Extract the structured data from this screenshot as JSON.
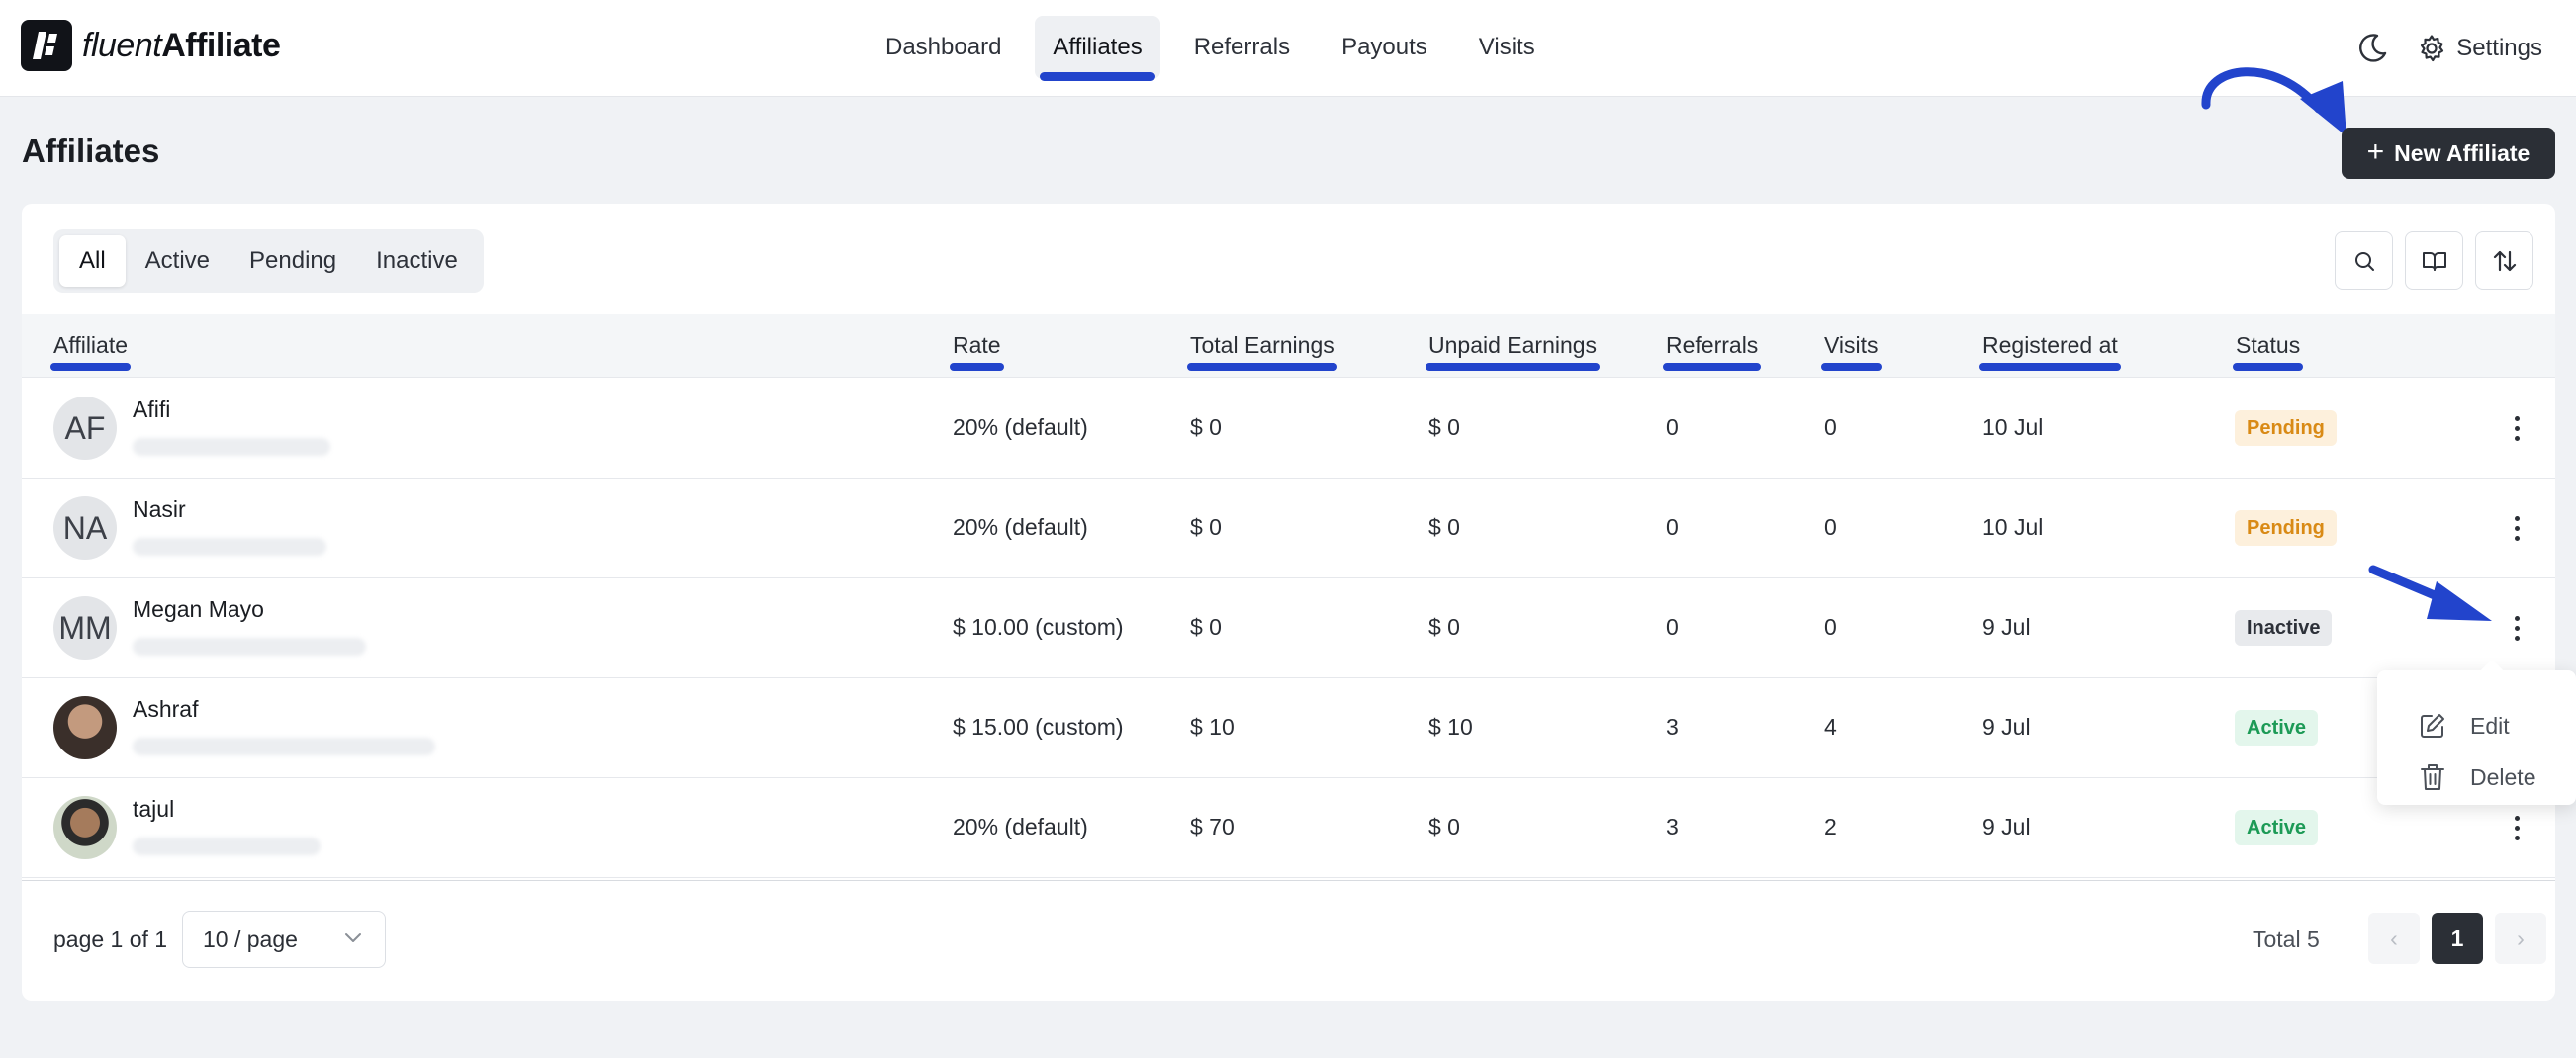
{
  "app": {
    "logo_light": "fluent",
    "logo_bold": "Affiliate"
  },
  "nav": {
    "items": [
      "Dashboard",
      "Affiliates",
      "Referrals",
      "Payouts",
      "Visits"
    ],
    "active": "Affiliates"
  },
  "header": {
    "settings_label": "Settings"
  },
  "page": {
    "title": "Affiliates",
    "new_button": "New Affiliate"
  },
  "filters": {
    "tabs": [
      "All",
      "Active",
      "Pending",
      "Inactive"
    ],
    "active": "All"
  },
  "table": {
    "columns": [
      "Affiliate",
      "Rate",
      "Total Earnings",
      "Unpaid Earnings",
      "Referrals",
      "Visits",
      "Registered at",
      "Status"
    ],
    "rows": [
      {
        "initials": "AF",
        "name": "Afifi",
        "rate": "20% (default)",
        "total": "$ 0",
        "unpaid": "$ 0",
        "referrals": "0",
        "visits": "0",
        "registered": "10 Jul",
        "status": "Pending"
      },
      {
        "initials": "NA",
        "name": "Nasir",
        "rate": "20% (default)",
        "total": "$ 0",
        "unpaid": "$ 0",
        "referrals": "0",
        "visits": "0",
        "registered": "10 Jul",
        "status": "Pending"
      },
      {
        "initials": "MM",
        "name": "Megan Mayo",
        "rate": "$ 10.00 (custom)",
        "total": "$ 0",
        "unpaid": "$ 0",
        "referrals": "0",
        "visits": "0",
        "registered": "9 Jul",
        "status": "Inactive"
      },
      {
        "initials": "",
        "name": "Ashraf",
        "rate": "$ 15.00 (custom)",
        "total": "$ 10",
        "unpaid": "$ 10",
        "referrals": "3",
        "visits": "4",
        "registered": "9 Jul",
        "status": "Active"
      },
      {
        "initials": "",
        "name": "tajul",
        "rate": "20% (default)",
        "total": "$ 70",
        "unpaid": "$ 0",
        "referrals": "3",
        "visits": "2",
        "registered": "9 Jul",
        "status": "Active"
      }
    ]
  },
  "row_menu": {
    "edit": "Edit",
    "delete": "Delete"
  },
  "footer": {
    "page_info": "page 1 of 1",
    "per_page": "10 / page",
    "total": "Total 5",
    "current_page": "1",
    "prev": "‹",
    "next": "›"
  },
  "colors": {
    "accent": "#2244cc",
    "dark_button": "#2b2f36",
    "pending": "#d98a15",
    "active": "#1c9a56"
  }
}
